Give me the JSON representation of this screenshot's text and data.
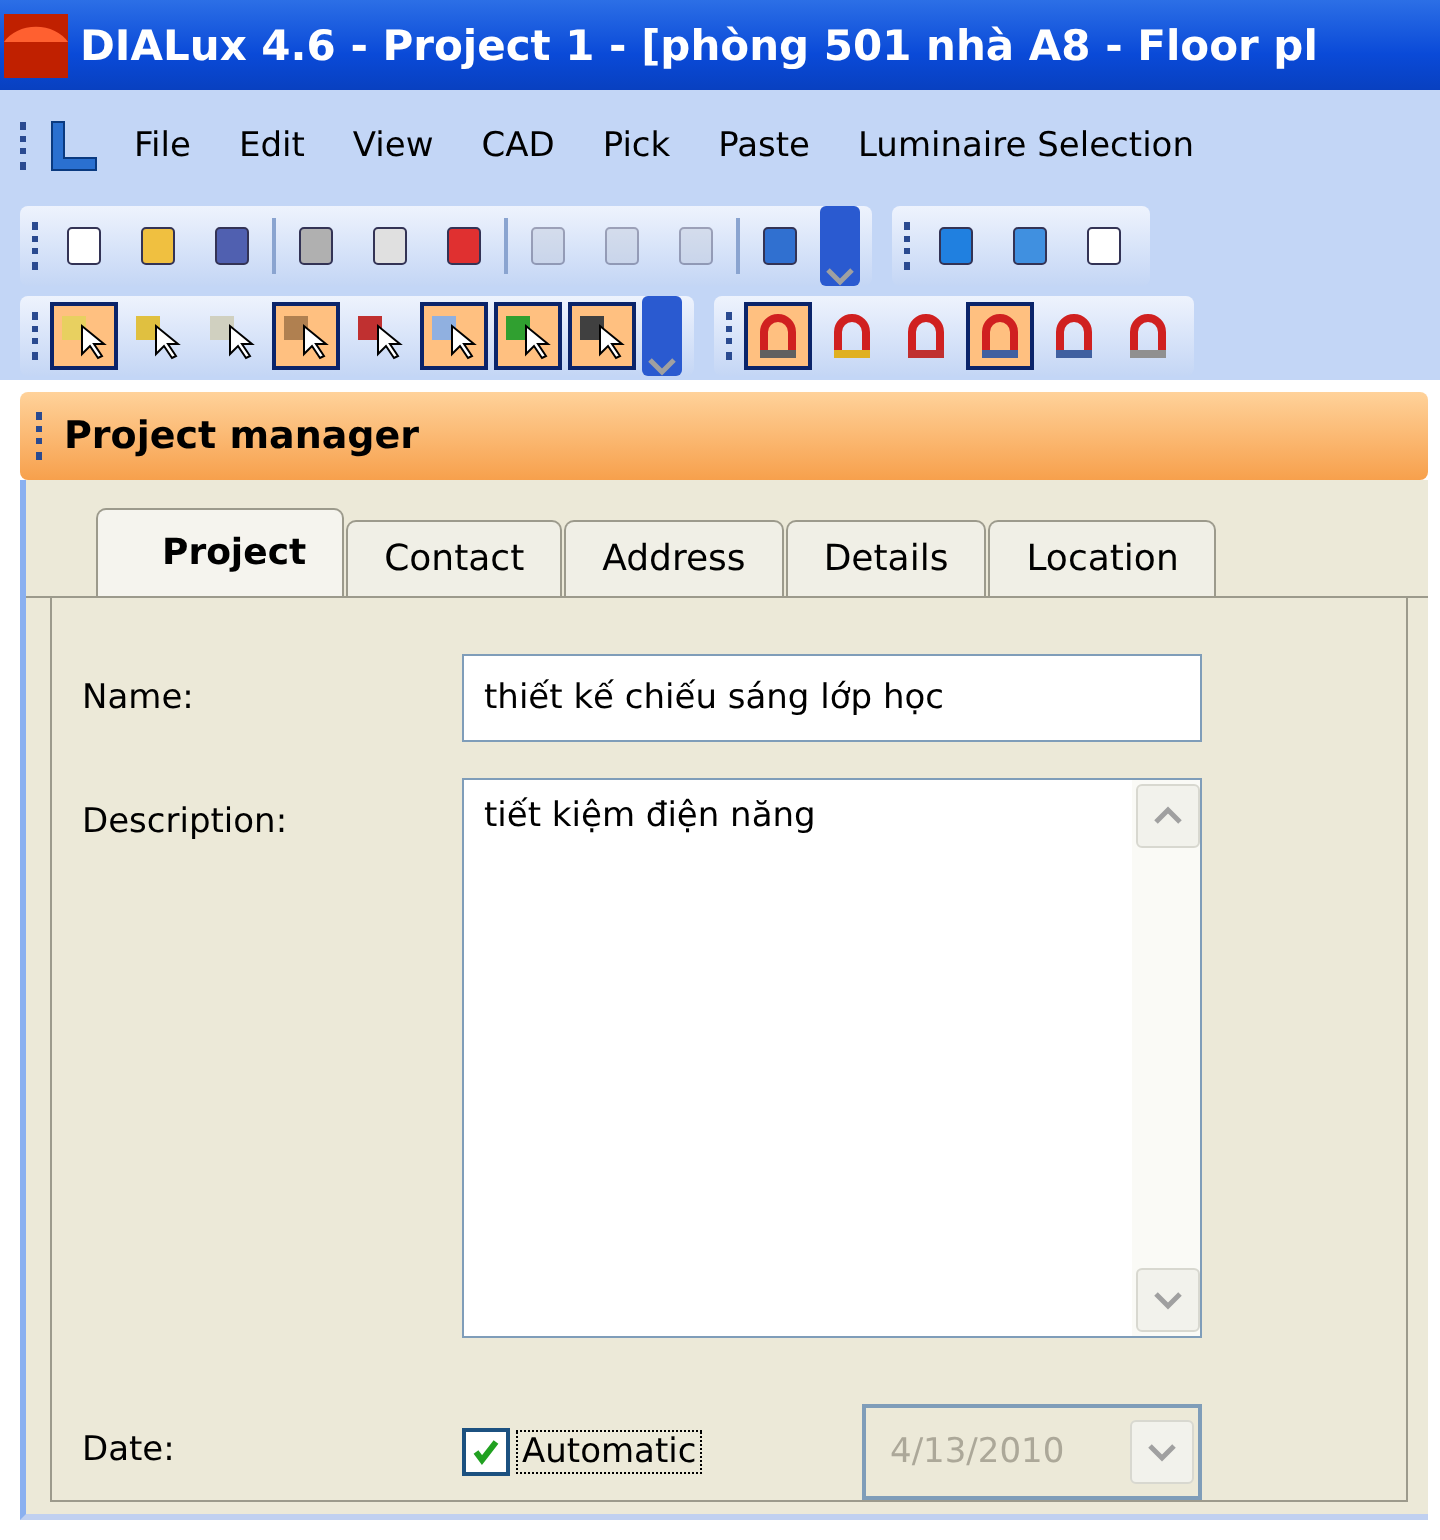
{
  "window": {
    "title": "DIALux 4.6 - Project 1 - [phòng 501 nhà A8  - Floor pl"
  },
  "menu": [
    "File",
    "Edit",
    "View",
    "CAD",
    "Pick",
    "Paste",
    "Luminaire Selection"
  ],
  "toolbar_1": {
    "buttons": [
      {
        "disabled": false
      },
      {
        "disabled": false
      },
      {
        "disabled": false
      },
      {
        "disabled": false
      },
      {
        "disabled": false
      },
      {
        "disabled": false
      },
      {
        "disabled": true
      },
      {
        "disabled": true
      },
      {
        "disabled": true
      },
      {
        "disabled": false
      }
    ]
  },
  "toolbar_2": {
    "buttons": [
      {
        "pressed": true
      },
      {
        "pressed": false
      },
      {
        "pressed": false
      },
      {
        "pressed": true
      },
      {
        "pressed": false
      },
      {
        "pressed": true
      },
      {
        "pressed": true
      },
      {
        "pressed": true
      }
    ]
  },
  "toolbar_3": {
    "buttons": [
      {
        "pressed": true
      },
      {
        "pressed": false
      },
      {
        "pressed": false
      },
      {
        "pressed": true
      },
      {
        "pressed": false
      },
      {
        "pressed": false
      }
    ]
  },
  "panel": {
    "title": "Project manager",
    "tabs": [
      {
        "label": "Project",
        "selected": true
      },
      {
        "label": "Contact",
        "selected": false
      },
      {
        "label": "Address",
        "selected": false
      },
      {
        "label": "Details",
        "selected": false
      },
      {
        "label": "Location",
        "selected": false
      }
    ],
    "name": {
      "label": "Name:",
      "value": "thiết kế chiếu sáng lớp học"
    },
    "description": {
      "label": "Description:",
      "value": "tiết kiệm điện năng"
    },
    "date": {
      "label": "Date:",
      "automatic": {
        "label": "Automatic",
        "checked": true
      },
      "value": "4/13/2010",
      "disabled": true
    }
  }
}
